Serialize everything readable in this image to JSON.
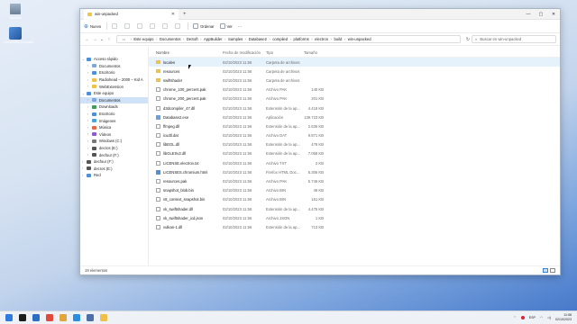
{
  "desktop": {
    "icons": [
      {
        "label": "Papelera"
      },
      {
        "label": "Decompiler.Emulator"
      }
    ]
  },
  "window": {
    "tab_title": "win-unpacked",
    "controls": [
      "—",
      "▢",
      "✕"
    ]
  },
  "toolbar": {
    "new_label": "Nuevo",
    "sort_label": "Ordenar",
    "view_label": "Ver",
    "more_label": "···"
  },
  "address": {
    "crumbs": [
      "Este equipo",
      "Documentos",
      "DeSoft",
      "AppBuilder",
      "Samples",
      "Database2",
      "compiled",
      "platforms",
      "electron",
      "build",
      "win-unpacked"
    ],
    "search_placeholder": "Buscar en win-unpacked"
  },
  "sidebar": {
    "items": [
      {
        "label": "Acceso rápido",
        "level": 0,
        "icon": "star-icon",
        "color": "#4e8fd8",
        "expanded": true
      },
      {
        "label": "Documentos",
        "level": 1,
        "icon": "documents-icon",
        "color": "#7fa8d6"
      },
      {
        "label": "Escritorio",
        "level": 1,
        "icon": "desktop-icon",
        "color": "#4e8fd8"
      },
      {
        "label": "Radiohead – 2000 – Kid A",
        "level": 1,
        "icon": "folder-icon",
        "color": "#f0c04a"
      },
      {
        "label": "WebExtension",
        "level": 1,
        "icon": "folder-icon",
        "color": "#f0c04a"
      },
      {
        "label": "Este equipo",
        "level": 0,
        "icon": "computer-icon",
        "color": "#4e8fd8",
        "expanded": true
      },
      {
        "label": "Documentos",
        "level": 1,
        "icon": "documents-icon",
        "color": "#7fa8d6",
        "selected": true
      },
      {
        "label": "Downloads",
        "level": 1,
        "icon": "download-icon",
        "color": "#3f9b5a"
      },
      {
        "label": "Escritorio",
        "level": 1,
        "icon": "desktop-icon",
        "color": "#4e8fd8"
      },
      {
        "label": "Imágenes",
        "level": 1,
        "icon": "pictures-icon",
        "color": "#4aa3d8"
      },
      {
        "label": "Música",
        "level": 1,
        "icon": "music-icon",
        "color": "#e26a4a"
      },
      {
        "label": "Vídeos",
        "level": 1,
        "icon": "videos-icon",
        "color": "#8a5bd0"
      },
      {
        "label": "Windows (C:)",
        "level": 1,
        "icon": "drive-icon",
        "color": "#777"
      },
      {
        "label": "decros (E:)",
        "level": 1,
        "icon": "drive-icon",
        "color": "#555"
      },
      {
        "label": "decfour (F:)",
        "level": 1,
        "icon": "drive-icon",
        "color": "#555"
      },
      {
        "label": "decfour (F:)",
        "level": 0,
        "icon": "drive-icon",
        "color": "#555"
      },
      {
        "label": "decros (E:)",
        "level": 0,
        "icon": "drive-icon",
        "color": "#555"
      },
      {
        "label": "Red",
        "level": 0,
        "icon": "network-icon",
        "color": "#4e8fd8"
      }
    ]
  },
  "columns": {
    "name": "Nombre",
    "date": "Fecha de modificación",
    "type": "Tipo",
    "size": "Tamaño"
  },
  "files": [
    {
      "name": "locales",
      "date": "02/10/2023 11:56",
      "type": "Carpeta de archivos",
      "size": "",
      "kind": "folder"
    },
    {
      "name": "resources",
      "date": "02/10/2023 11:56",
      "type": "Carpeta de archivos",
      "size": "",
      "kind": "folder"
    },
    {
      "name": "swiftshader",
      "date": "02/10/2023 11:56",
      "type": "Carpeta de archivos",
      "size": "",
      "kind": "folder"
    },
    {
      "name": "chrome_100_percent.pak",
      "date": "02/10/2023 11:56",
      "type": "Archivo PAK",
      "size": "140 KB",
      "kind": "file"
    },
    {
      "name": "chrome_200_percent.pak",
      "date": "02/10/2023 11:56",
      "type": "Archivo PAK",
      "size": "201 KB",
      "kind": "file"
    },
    {
      "name": "d3dcompiler_47.dll",
      "date": "02/10/2023 11:56",
      "type": "Extensión de la ap...",
      "size": "4.418 KB",
      "kind": "file"
    },
    {
      "name": "Database2.exe",
      "date": "02/10/2023 11:56",
      "type": "Aplicación",
      "size": "139.723 KB",
      "kind": "app"
    },
    {
      "name": "ffmpeg.dll",
      "date": "02/10/2023 11:56",
      "type": "Extensión de la ap...",
      "size": "2.636 KB",
      "kind": "file"
    },
    {
      "name": "icudtl.dat",
      "date": "02/10/2023 11:56",
      "type": "Archivo DAT",
      "size": "9.871 KB",
      "kind": "file"
    },
    {
      "name": "libEGL.dll",
      "date": "02/10/2023 11:56",
      "type": "Extensión de la ap...",
      "size": "478 KB",
      "kind": "file"
    },
    {
      "name": "libGLESv2.dll",
      "date": "02/10/2023 11:56",
      "type": "Extensión de la ap...",
      "size": "7.058 KB",
      "kind": "file"
    },
    {
      "name": "LICENSE.electron.txt",
      "date": "02/10/2023 11:56",
      "type": "Archivo TXT",
      "size": "2 KB",
      "kind": "file"
    },
    {
      "name": "LICENSES.chromium.html",
      "date": "02/10/2023 11:56",
      "type": "Firefox HTML Doc...",
      "size": "5.306 KB",
      "kind": "html"
    },
    {
      "name": "resources.pak",
      "date": "02/10/2023 11:56",
      "type": "Archivo PAK",
      "size": "5.746 KB",
      "kind": "file"
    },
    {
      "name": "snapshot_blob.bin",
      "date": "02/10/2023 11:56",
      "type": "Archivo BIN",
      "size": "49 KB",
      "kind": "file"
    },
    {
      "name": "v8_context_snapshot.bin",
      "date": "02/10/2023 11:56",
      "type": "Archivo BIN",
      "size": "161 KB",
      "kind": "file"
    },
    {
      "name": "vk_swiftshader.dll",
      "date": "02/10/2023 11:56",
      "type": "Extensión de la ap...",
      "size": "4.475 KB",
      "kind": "file"
    },
    {
      "name": "vk_swiftshader_icd.json",
      "date": "02/10/2023 11:56",
      "type": "Archivo JSON",
      "size": "1 KB",
      "kind": "file"
    },
    {
      "name": "vulkan-1.dll",
      "date": "02/10/2023 11:56",
      "type": "Extensión de la ap...",
      "size": "713 KB",
      "kind": "file"
    }
  ],
  "status": {
    "count": "19 elementos"
  },
  "taskbar": {
    "apps": [
      {
        "icon": "windows-start-icon",
        "color": "#2f7be0"
      },
      {
        "icon": "terminal-icon",
        "color": "#1d1d1d"
      },
      {
        "icon": "files-icon",
        "color": "#2b6fc4"
      },
      {
        "icon": "chrome-icon",
        "color": "#e04a3c"
      },
      {
        "icon": "chrome-canary-icon",
        "color": "#e0a53c"
      },
      {
        "icon": "vscode-icon",
        "color": "#2a8fe0"
      },
      {
        "icon": "app-icon",
        "color": "#4c6fa8"
      },
      {
        "icon": "file-explorer-icon",
        "color": "#f0c04a"
      }
    ],
    "lang": "ESP",
    "time": "11:58",
    "date": "02/10/2023"
  }
}
